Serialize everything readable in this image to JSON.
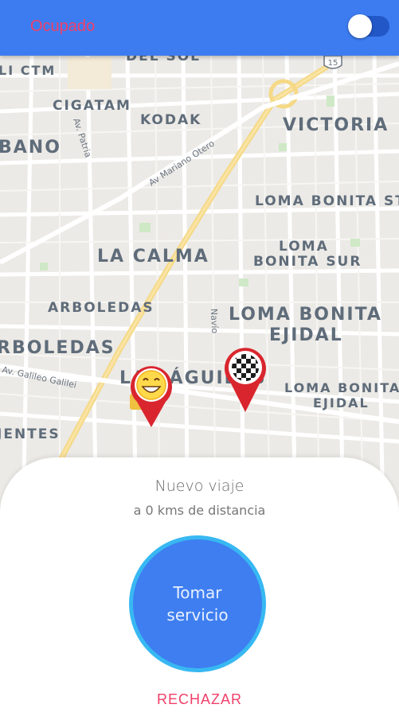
{
  "header": {
    "status_label": "Ocupado",
    "toggle_on": false,
    "bar_color": "#3d7cf0",
    "status_color": "#f0406a"
  },
  "map": {
    "neighborhoods": [
      "LI CTM",
      "CIGATAM",
      "KODAK",
      "VICTORIA",
      "BANO",
      "LOMA BONITA STA",
      "LA CALMA",
      "LOMA",
      "BONITA SUR",
      "ARBOLEDAS",
      "LOMA BONITA",
      "EJIDAL",
      "RBOLEDAS",
      "LAS ÁGUILAS",
      "LOMA BONITA",
      "EJIDAL",
      "JENTES",
      "DEL SOL"
    ],
    "streets": [
      "Av. Patria",
      "Av Mariano Otero",
      "Navío",
      "Av. Galileo Galilei"
    ],
    "highway_shield": "15",
    "driver_marker_icon": "smiley-face-icon",
    "destination_marker_icon": "checkered-flag-icon"
  },
  "request": {
    "title": "Nuevo viaje",
    "distance_text": "a 0 kms de distancia",
    "accept_label_line1": "Tomar",
    "accept_label_line2": "servicio",
    "reject_label": "RECHAZAR",
    "accept_color": "#3e7ef0",
    "reject_color": "#f0406a"
  }
}
